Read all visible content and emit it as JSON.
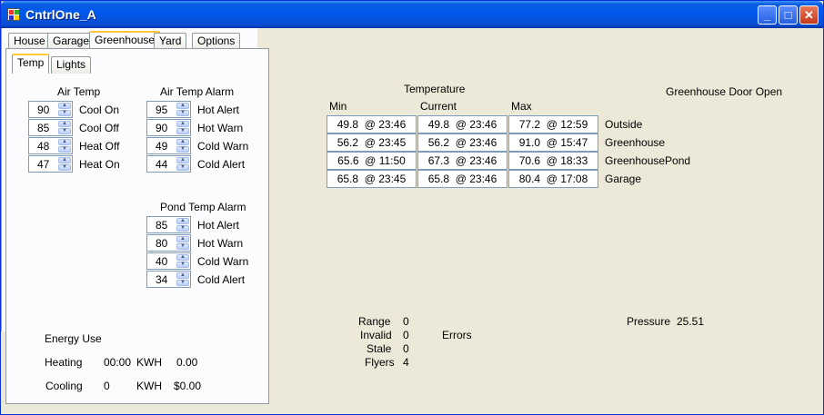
{
  "window": {
    "title": "CntrlOne_A"
  },
  "tabs": [
    "House",
    "Garage",
    "Greenhouse",
    "Yard",
    "Options"
  ],
  "subtabs": [
    "Temp",
    "Lights"
  ],
  "air_temp": {
    "heading": "Air Temp",
    "rows": [
      {
        "value": "90",
        "label": "Cool On"
      },
      {
        "value": "85",
        "label": "Cool Off"
      },
      {
        "value": "48",
        "label": "Heat Off"
      },
      {
        "value": "47",
        "label": "Heat On"
      }
    ]
  },
  "air_temp_alarm": {
    "heading": "Air Temp Alarm",
    "rows": [
      {
        "value": "95",
        "label": "Hot Alert"
      },
      {
        "value": "90",
        "label": "Hot Warn"
      },
      {
        "value": "49",
        "label": "Cold Warn"
      },
      {
        "value": "44",
        "label": "Cold Alert"
      }
    ]
  },
  "pond_temp_alarm": {
    "heading": "Pond Temp Alarm",
    "rows": [
      {
        "value": "85",
        "label": "Hot Alert"
      },
      {
        "value": "80",
        "label": "Hot Warn"
      },
      {
        "value": "40",
        "label": "Cold Warn"
      },
      {
        "value": "34",
        "label": "Cold Alert"
      }
    ]
  },
  "energy": {
    "heading": "Energy Use",
    "heating_label": "Heating",
    "heating_time": "00:00",
    "heating_unit": "KWH",
    "heating_value": "0.00",
    "cooling_label": "Cooling",
    "cooling_time": "0",
    "cooling_unit": "KWH",
    "cooling_value": "$0.00"
  },
  "temperature": {
    "heading": "Temperature",
    "col_min": "Min",
    "col_current": "Current",
    "col_max": "Max",
    "rows": [
      {
        "min": "49.8  @ 23:46",
        "current": "49.8  @ 23:46",
        "max": "77.2  @ 12:59",
        "name": "Outside"
      },
      {
        "min": "56.2  @ 23:45",
        "current": "56.2  @ 23:46",
        "max": "91.0  @ 15:47",
        "name": "Greenhouse"
      },
      {
        "min": "65.6  @ 11:50",
        "current": "67.3  @ 23:46",
        "max": "70.6  @ 18:33",
        "name": "GreenhousePond"
      },
      {
        "min": "65.8  @ 23:45",
        "current": "65.8  @ 23:46",
        "max": "80.4  @ 17:08",
        "name": "Garage"
      }
    ]
  },
  "door_status": "Greenhouse Door Open",
  "stats": {
    "range_label": "Range",
    "range_value": "0",
    "invalid_label": "Invalid",
    "invalid_value": "0",
    "stale_label": "Stale",
    "stale_value": "0",
    "flyers_label": "Flyers",
    "flyers_value": "4",
    "errors_label": "Errors"
  },
  "pressure": {
    "label": "Pressure",
    "value": "25.51"
  },
  "icons": {
    "app": "app-icon",
    "minimize": "minimize-icon",
    "maximize": "maximize-icon",
    "close": "close-icon"
  }
}
